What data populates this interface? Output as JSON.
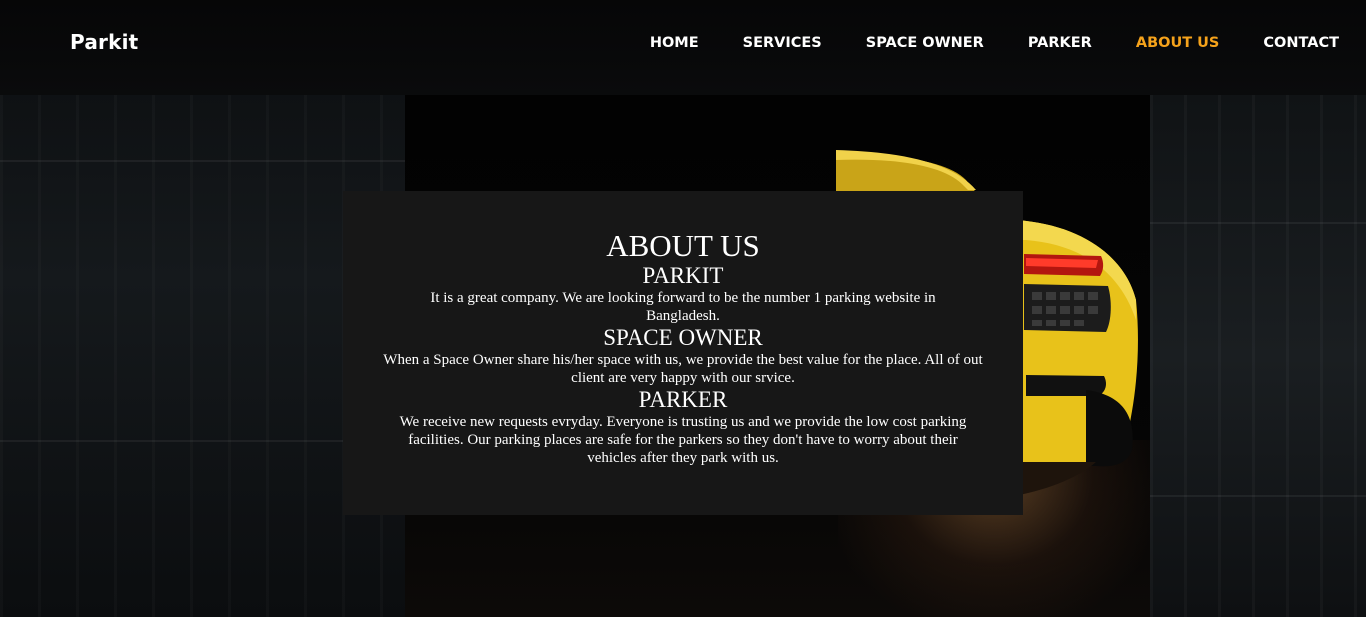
{
  "brand": {
    "name": "Parkit"
  },
  "nav": {
    "items": [
      {
        "label": "HOME",
        "active": false
      },
      {
        "label": "SERVICES",
        "active": false
      },
      {
        "label": "SPACE OWNER",
        "active": false
      },
      {
        "label": "PARKER",
        "active": false
      },
      {
        "label": "ABOUT US",
        "active": true
      },
      {
        "label": "CONTACT",
        "active": false
      }
    ]
  },
  "about": {
    "title": "ABOUT US",
    "sections": [
      {
        "heading": "PARKIT",
        "text": "It is a great company. We are looking forward to be the number 1 parking website in Bangladesh."
      },
      {
        "heading": "SPACE OWNER",
        "text": "When a Space Owner share his/her space with us, we provide the best value for the place. All of out client are very happy with our srvice."
      },
      {
        "heading": "PARKER",
        "text": "We receive new requests evryday. Everyone is trusting us and we provide the low cost parking facilities. Our parking places are safe for the parkers so they don't have to worry about their vehicles after they park with us."
      }
    ]
  },
  "colors": {
    "accent": "#f5a21b",
    "box_background": "#171717",
    "car_yellow": "#e8c21a"
  },
  "background_image": "yellow-sports-car-rear-in-dark-garage"
}
